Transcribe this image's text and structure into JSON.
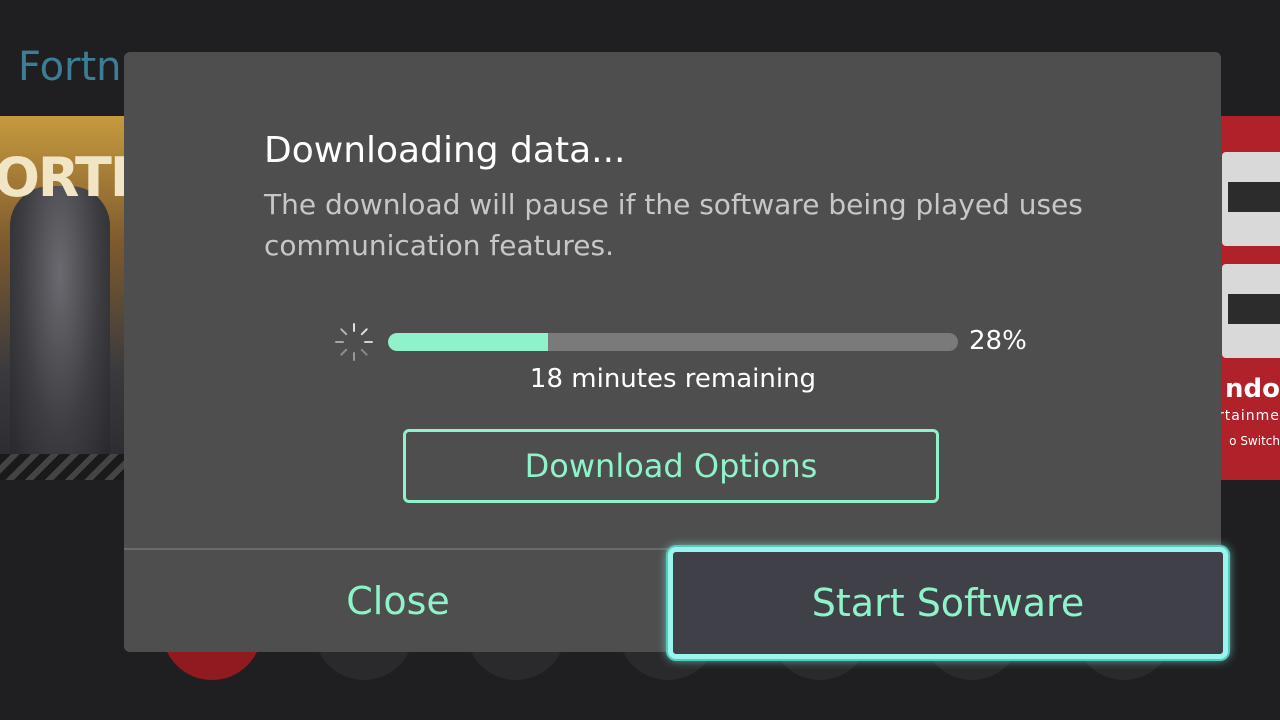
{
  "background": {
    "title_fragment": "Fortn",
    "left_tile_logo": "ORTN",
    "right_tile_brand": "ndo",
    "right_tile_brand2": "rtainment",
    "right_tile_brand3": "o Switch"
  },
  "dialog": {
    "title": "Downloading data...",
    "message": "The download will pause if the software being played uses communication features.",
    "progress": {
      "percent_label": "28%",
      "fraction": 0.28,
      "remaining": "18 minutes remaining"
    },
    "options_button": "Download Options",
    "close_button": "Close",
    "start_button": "Start Software"
  },
  "colors": {
    "accent": "#8ff3c9",
    "focus_ring": "#9cf5ec",
    "dialog_bg": "#4e4e4e"
  },
  "icons": {
    "spinner": "loading-spinner-icon"
  }
}
